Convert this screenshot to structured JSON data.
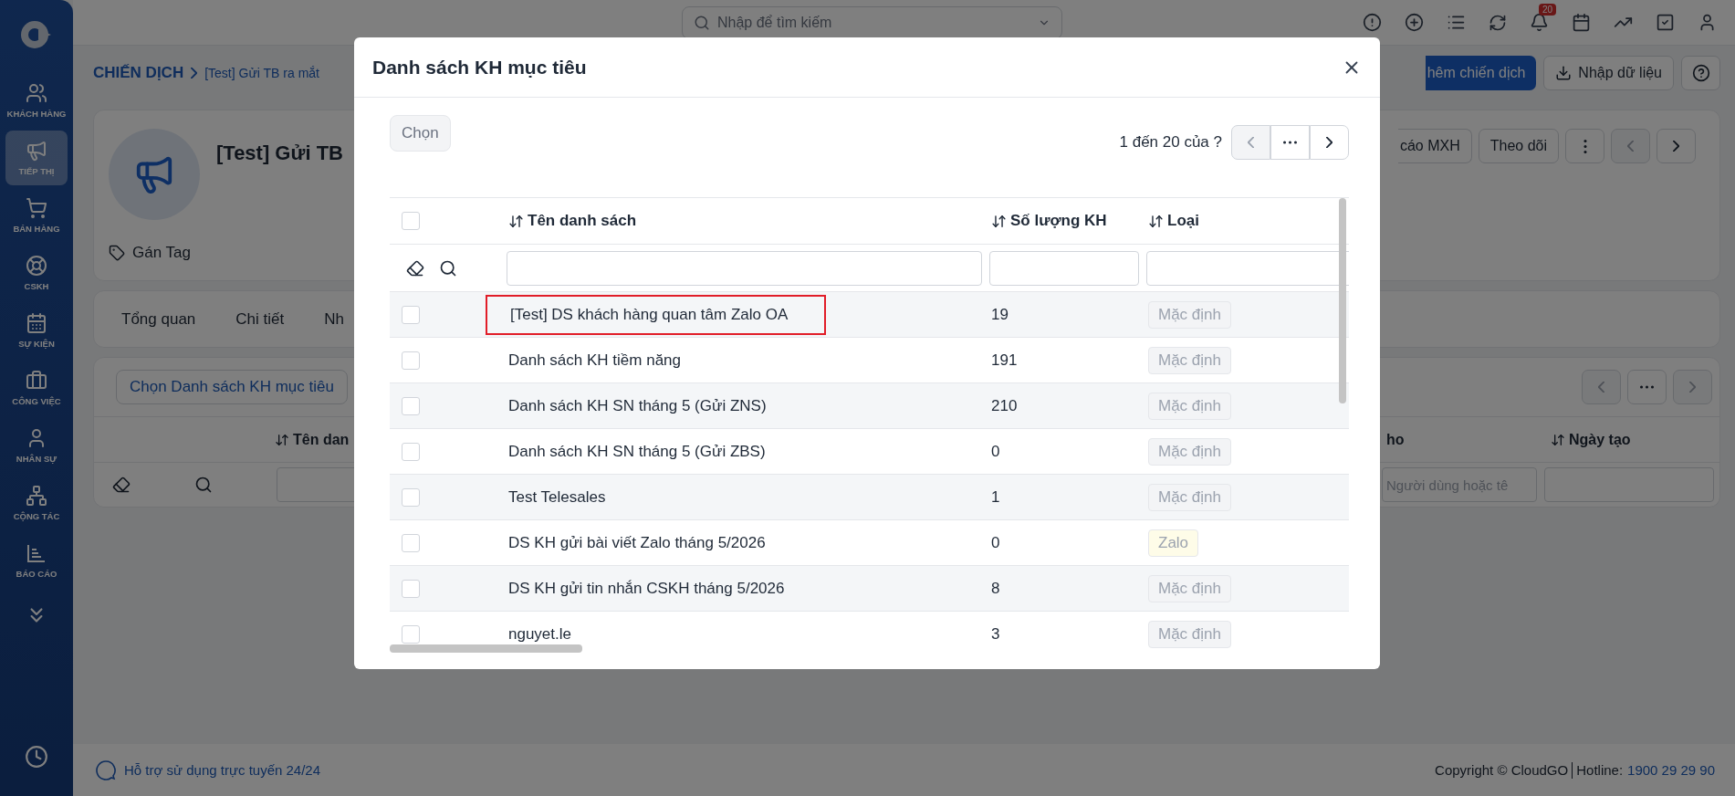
{
  "sidebar": {
    "items": [
      {
        "label": "KHÁCH HÀNG",
        "selected": false
      },
      {
        "label": "TIẾP THỊ",
        "selected": true
      },
      {
        "label": "BÁN HÀNG",
        "selected": false
      },
      {
        "label": "CSKH",
        "selected": false
      },
      {
        "label": "SỰ KIỆN",
        "selected": false
      },
      {
        "label": "CÔNG VIỆC",
        "selected": false
      },
      {
        "label": "NHÂN SỰ",
        "selected": false
      },
      {
        "label": "CỘNG TÁC",
        "selected": false
      },
      {
        "label": "BÁO CÁO",
        "selected": false
      }
    ]
  },
  "topbar": {
    "search": {
      "placeholder": "Nhập để tìm kiếm"
    },
    "notification_count": "20"
  },
  "breadcrumb": {
    "root": "CHIẾN DỊCH",
    "current": "[Test] Gửi TB ra mắt"
  },
  "header_buttons": [
    "hêm chiến dịch",
    "Nhập dữ liệu"
  ],
  "campaign": {
    "title": "[Test] Gửi TB",
    "tag_label": "Gán Tag",
    "buttons": [
      "cáo MXH",
      "Theo dõi"
    ]
  },
  "tabs": [
    "Tổng quan",
    "Chi tiết",
    "Nh"
  ],
  "target_lists": {
    "select_button": "Chọn Danh sách KH mục tiêu",
    "columns": [
      "Tên dan",
      "ho",
      "Ngày tạo"
    ],
    "filter_placeholder": "Người dùng hoặc tê"
  },
  "dialog": {
    "title": "Danh sách KH mục tiêu",
    "choose_button": "Chọn",
    "pagination": "1 đến 20 của ?",
    "prev_disabled": true,
    "select_all_checked": false,
    "columns": [
      "Tên danh sách",
      "Số lượng KH",
      "Loại"
    ],
    "rows": [
      {
        "name": "[Test] DS khách hàng quan tâm Zalo OA",
        "count": "19",
        "type": "Mặc định",
        "color": "#f3f4f6",
        "checked": false,
        "highlighted": true
      },
      {
        "name": "Danh sách KH tiềm năng",
        "count": "191",
        "type": "Mặc định",
        "color": "#f3f4f6",
        "checked": false,
        "highlighted": false
      },
      {
        "name": "Danh sách KH SN tháng 5 (Gửi ZNS)",
        "count": "210",
        "type": "Mặc định",
        "color": "#f3f4f6",
        "checked": false,
        "highlighted": false
      },
      {
        "name": "Danh sách KH SN tháng 5 (Gửi ZBS)",
        "count": "0",
        "type": "Mặc định",
        "color": "#f3f4f6",
        "checked": false,
        "highlighted": false
      },
      {
        "name": "Test Telesales",
        "count": "1",
        "type": "Mặc định",
        "color": "#f3f4f6",
        "checked": false,
        "highlighted": false
      },
      {
        "name": "DS KH gửi bài viết Zalo tháng 5/2026",
        "count": "0",
        "type": "Zalo",
        "color": "#fefce8",
        "checked": false,
        "highlighted": false
      },
      {
        "name": "DS KH gửi tin nhắn CSKH tháng 5/2026",
        "count": "8",
        "type": "Mặc định",
        "color": "#f3f4f6",
        "checked": false,
        "highlighted": false
      },
      {
        "name": "nguyet.le",
        "count": "3",
        "type": "Mặc định",
        "color": "#f3f4f6",
        "checked": false,
        "highlighted": false
      }
    ]
  },
  "footer": {
    "support": "Hỗ trợ sử dụng trực tuyến 24/24",
    "copyright": "Copyright © CloudGO",
    "hotline_label": "Hotline:",
    "hotline": "1900 29 29 90"
  }
}
